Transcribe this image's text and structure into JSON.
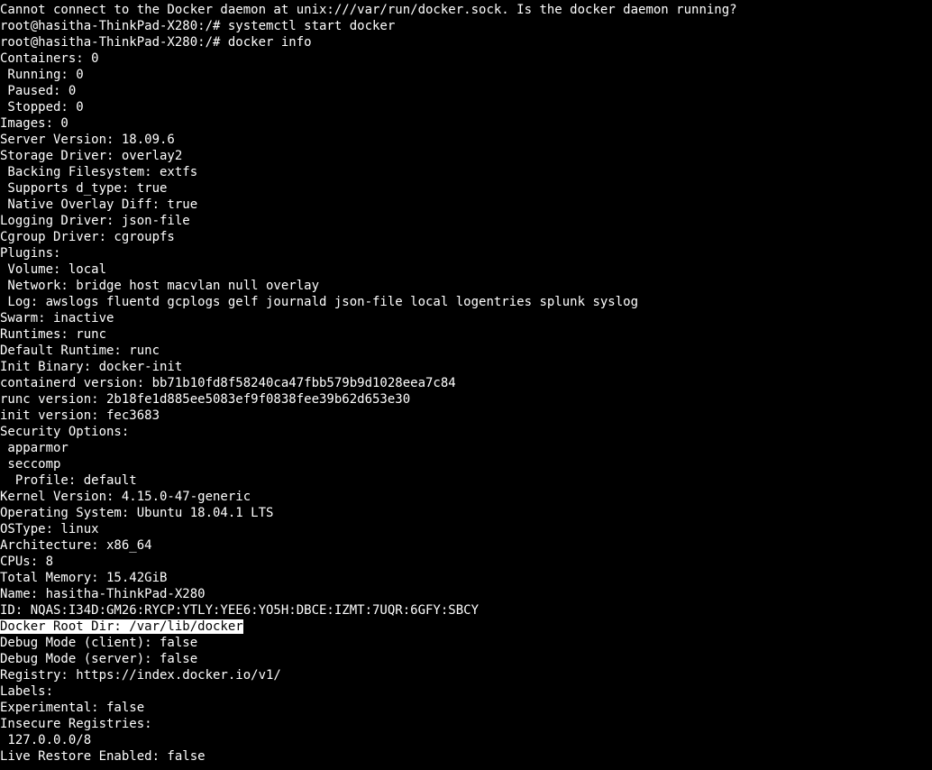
{
  "lines": [
    {
      "text": "Cannot connect to the Docker daemon at unix:///var/run/docker.sock. Is the docker daemon running?",
      "cls": ""
    },
    {
      "text": "root@hasitha-ThinkPad-X280:/# systemctl start docker",
      "cls": ""
    },
    {
      "text": "root@hasitha-ThinkPad-X280:/# docker info",
      "cls": ""
    },
    {
      "text": "Containers: 0",
      "cls": ""
    },
    {
      "text": " Running: 0",
      "cls": ""
    },
    {
      "text": " Paused: 0",
      "cls": ""
    },
    {
      "text": " Stopped: 0",
      "cls": ""
    },
    {
      "text": "Images: 0",
      "cls": ""
    },
    {
      "text": "Server Version: 18.09.6",
      "cls": ""
    },
    {
      "text": "Storage Driver: overlay2",
      "cls": ""
    },
    {
      "text": " Backing Filesystem: extfs",
      "cls": ""
    },
    {
      "text": " Supports d_type: true",
      "cls": ""
    },
    {
      "text": " Native Overlay Diff: true",
      "cls": ""
    },
    {
      "text": "Logging Driver: json-file",
      "cls": ""
    },
    {
      "text": "Cgroup Driver: cgroupfs",
      "cls": ""
    },
    {
      "text": "Plugins:",
      "cls": ""
    },
    {
      "text": " Volume: local",
      "cls": ""
    },
    {
      "text": " Network: bridge host macvlan null overlay",
      "cls": ""
    },
    {
      "text": " Log: awslogs fluentd gcplogs gelf journald json-file local logentries splunk syslog",
      "cls": ""
    },
    {
      "text": "Swarm: inactive",
      "cls": ""
    },
    {
      "text": "Runtimes: runc",
      "cls": ""
    },
    {
      "text": "Default Runtime: runc",
      "cls": ""
    },
    {
      "text": "Init Binary: docker-init",
      "cls": ""
    },
    {
      "text": "containerd version: bb71b10fd8f58240ca47fbb579b9d1028eea7c84",
      "cls": ""
    },
    {
      "text": "runc version: 2b18fe1d885ee5083ef9f0838fee39b62d653e30",
      "cls": ""
    },
    {
      "text": "init version: fec3683",
      "cls": ""
    },
    {
      "text": "Security Options:",
      "cls": ""
    },
    {
      "text": " apparmor",
      "cls": ""
    },
    {
      "text": " seccomp",
      "cls": ""
    },
    {
      "text": "  Profile: default",
      "cls": ""
    },
    {
      "text": "Kernel Version: 4.15.0-47-generic",
      "cls": ""
    },
    {
      "text": "Operating System: Ubuntu 18.04.1 LTS",
      "cls": ""
    },
    {
      "text": "OSType: linux",
      "cls": ""
    },
    {
      "text": "Architecture: x86_64",
      "cls": ""
    },
    {
      "text": "CPUs: 8",
      "cls": ""
    },
    {
      "text": "Total Memory: 15.42GiB",
      "cls": ""
    },
    {
      "text": "Name: hasitha-ThinkPad-X280",
      "cls": ""
    },
    {
      "text": "ID: NQAS:I34D:GM26:RYCP:YTLY:YEE6:YO5H:DBCE:IZMT:7UQR:6GFY:SBCY",
      "cls": ""
    },
    {
      "text": "Docker Root Dir: /var/lib/docker",
      "cls": "highlight"
    },
    {
      "text": "Debug Mode (client): false",
      "cls": ""
    },
    {
      "text": "Debug Mode (server): false",
      "cls": ""
    },
    {
      "text": "Registry: https://index.docker.io/v1/",
      "cls": ""
    },
    {
      "text": "Labels:",
      "cls": ""
    },
    {
      "text": "Experimental: false",
      "cls": ""
    },
    {
      "text": "Insecure Registries:",
      "cls": ""
    },
    {
      "text": " 127.0.0.0/8",
      "cls": ""
    },
    {
      "text": "Live Restore Enabled: false",
      "cls": ""
    }
  ]
}
